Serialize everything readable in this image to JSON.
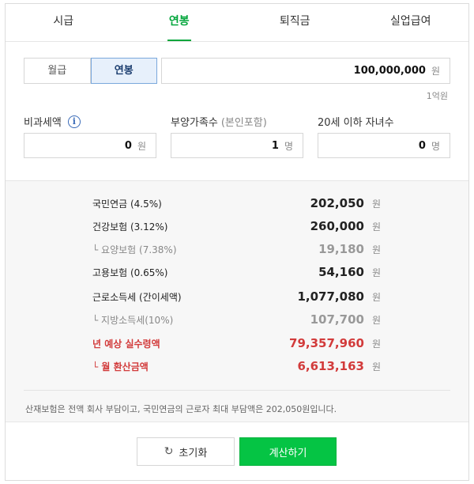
{
  "tabs": [
    {
      "label": "시급"
    },
    {
      "label": "연봉"
    },
    {
      "label": "퇴직금"
    },
    {
      "label": "실업급여"
    }
  ],
  "segment": {
    "monthly": "월급",
    "annual": "연봉"
  },
  "salary": {
    "value": "100,000,000",
    "unit": "원",
    "hint": "1억원"
  },
  "fields": {
    "nontax": {
      "label": "비과세액",
      "value": "0",
      "unit": "원"
    },
    "dependents": {
      "label": "부양가족수",
      "sub": "(본인포함)",
      "value": "1",
      "unit": "명"
    },
    "children": {
      "label": "20세 이하 자녀수",
      "value": "0",
      "unit": "명"
    }
  },
  "results": [
    {
      "label": "국민연금 (4.5%)",
      "value": "202,050",
      "unit": "원"
    },
    {
      "label": "건강보험 (3.12%)",
      "value": "260,000",
      "unit": "원"
    },
    {
      "label": "└ 요양보험 (7.38%)",
      "value": "19,180",
      "unit": "원"
    },
    {
      "label": "고용보험 (0.65%)",
      "value": "54,160",
      "unit": "원"
    },
    {
      "label": "근로소득세 (간이세액)",
      "value": "1,077,080",
      "unit": "원"
    },
    {
      "label": "└ 지방소득세(10%)",
      "value": "107,700",
      "unit": "원"
    },
    {
      "label": "년 예상 실수령액",
      "value": "79,357,960",
      "unit": "원"
    },
    {
      "label": "└ 월 환산금액",
      "value": "6,613,163",
      "unit": "원"
    }
  ],
  "note": "산재보험은 전액 회사 부담이고, 국민연금의 근로자 최대 부담액은 202,050원입니다.",
  "buttons": {
    "reset": "초기화",
    "calc": "계산하기"
  },
  "colors": {
    "accent": "#03a63c",
    "highlight": "#d23b3b",
    "selected": "#e7f0fb"
  }
}
